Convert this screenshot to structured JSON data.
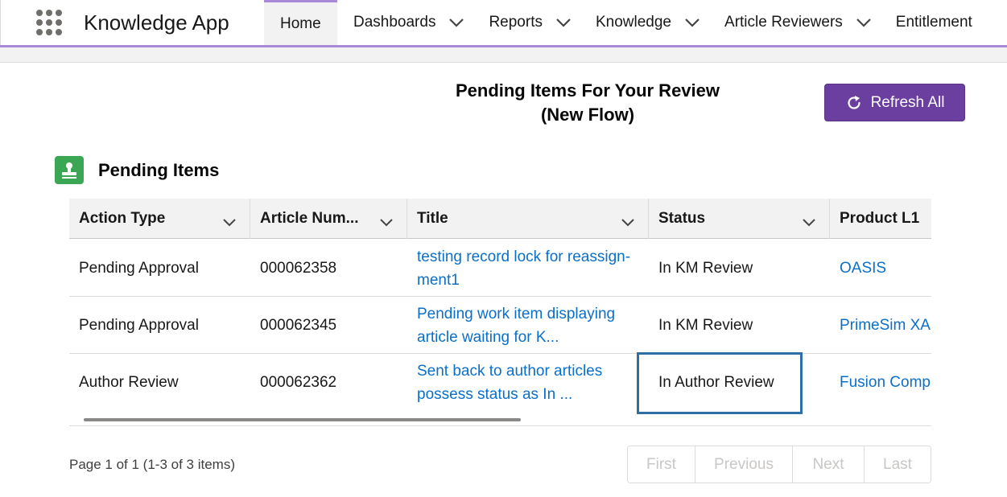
{
  "app": {
    "name": "Knowledge App"
  },
  "nav": {
    "items": [
      {
        "label": "Home",
        "active": true,
        "has_menu": false
      },
      {
        "label": "Dashboards",
        "active": false,
        "has_menu": true
      },
      {
        "label": "Reports",
        "active": false,
        "has_menu": true
      },
      {
        "label": "Knowledge",
        "active": false,
        "has_menu": true
      },
      {
        "label": "Article Reviewers",
        "active": false,
        "has_menu": true
      },
      {
        "label": "Entitlement",
        "active": false,
        "has_menu": false
      }
    ]
  },
  "header": {
    "title_line1": "Pending Items For Your Review",
    "title_line2": "(New Flow)",
    "refresh_label": "Refresh All",
    "refresh_icon": "refresh-icon"
  },
  "card": {
    "title": "Pending Items",
    "icon": "approval-stamp-icon"
  },
  "table": {
    "columns": [
      "Action Type",
      "Article Num...",
      "Title",
      "Status",
      "Product L1"
    ],
    "rows": [
      {
        "action_type": "Pending Approval",
        "article_number": "000062358",
        "title_line1": "testing record lock for reassign-",
        "title_line2": "ment1",
        "status": "In KM Review",
        "product_l1": "OASIS"
      },
      {
        "action_type": "Pending Approval",
        "article_number": "000062345",
        "title_line1": "Pending work item displaying",
        "title_line2": "article waiting for K...",
        "status": "In KM Review",
        "product_l1": "PrimeSim XA"
      },
      {
        "action_type": "Author Review",
        "article_number": "000062362",
        "title_line1": "Sent back to author articles",
        "title_line2": "possess status as In ...",
        "status": "In Author Review",
        "product_l1": "Fusion Comp"
      }
    ]
  },
  "pagination": {
    "info": "Page 1 of 1 (1-3 of 3 items)",
    "first": "First",
    "previous": "Previous",
    "next": "Next",
    "last": "Last"
  },
  "colors": {
    "accent": "#a98ad9",
    "button_primary": "#6b3fa0",
    "card_icon": "#3ba755",
    "link": "#0b6fc9",
    "focus": "#2e6fa6"
  }
}
